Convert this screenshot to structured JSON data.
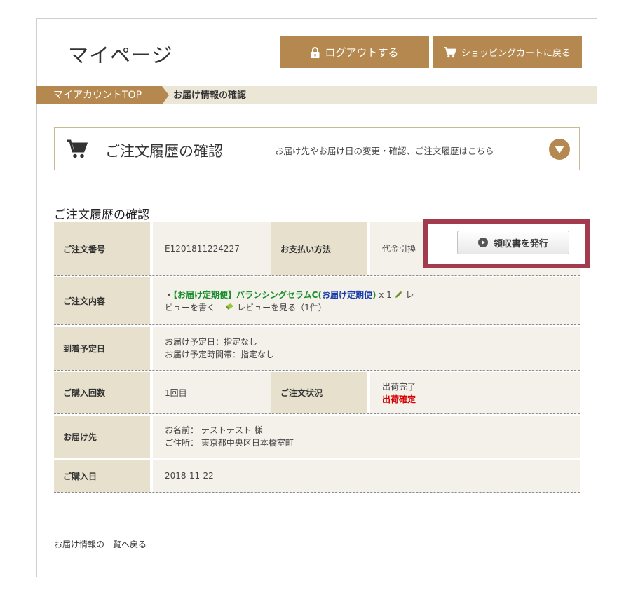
{
  "page_title": "マイページ",
  "header": {
    "logout_label": "ログアウトする",
    "cart_label": "ショッピングカートに戻る"
  },
  "breadcrumb": {
    "first": "マイアカウントTOP",
    "current": "お届け情報の確認"
  },
  "order_history_box": {
    "title": "ご注文履歴の確認",
    "description": "お届け先やお届け日の変更・確認、ご注文履歴はこちら"
  },
  "section_title": "ご注文履歴の確認",
  "table": {
    "order_number_label": "ご注文番号",
    "order_number": "E1201811224227",
    "payment_label": "お支払い方法",
    "payment_value": "代金引換",
    "receipt_button": "領収書を発行",
    "contents_label": "ご注文内容",
    "item_prefix": "・",
    "item_name_green": "【お届け定期便】バランシングセラムC(",
    "item_name_blue": "お届け定期便",
    "item_name_green_close": ")",
    "item_qty": " x 1 ",
    "review_write": "レビューを書く",
    "review_view": "レビューを見る（1件）",
    "arrival_label": "到着予定日",
    "arrival_date": "お届け予定日：指定なし",
    "arrival_time": "お届け予定時間帯：指定なし",
    "purchase_count_label": "ご購入回数",
    "purchase_count": "1回目",
    "status_label": "ご注文状況",
    "status_1": "出荷完了",
    "status_2": "出荷確定",
    "destination_label": "お届け先",
    "dest_name": "お名前： テストテスト 様",
    "dest_address": "ご住所： 東京都中央区日本橋室町",
    "purchase_date_label": "ご購入日",
    "purchase_date": "2018-11-22"
  },
  "back_link": "お届け情報の一覧へ戻る",
  "colors": {
    "brand_gold": "#b5884f",
    "header_cell": "#e6e0cc",
    "highlight": "#a33b4e",
    "status_red": "#d60000"
  }
}
